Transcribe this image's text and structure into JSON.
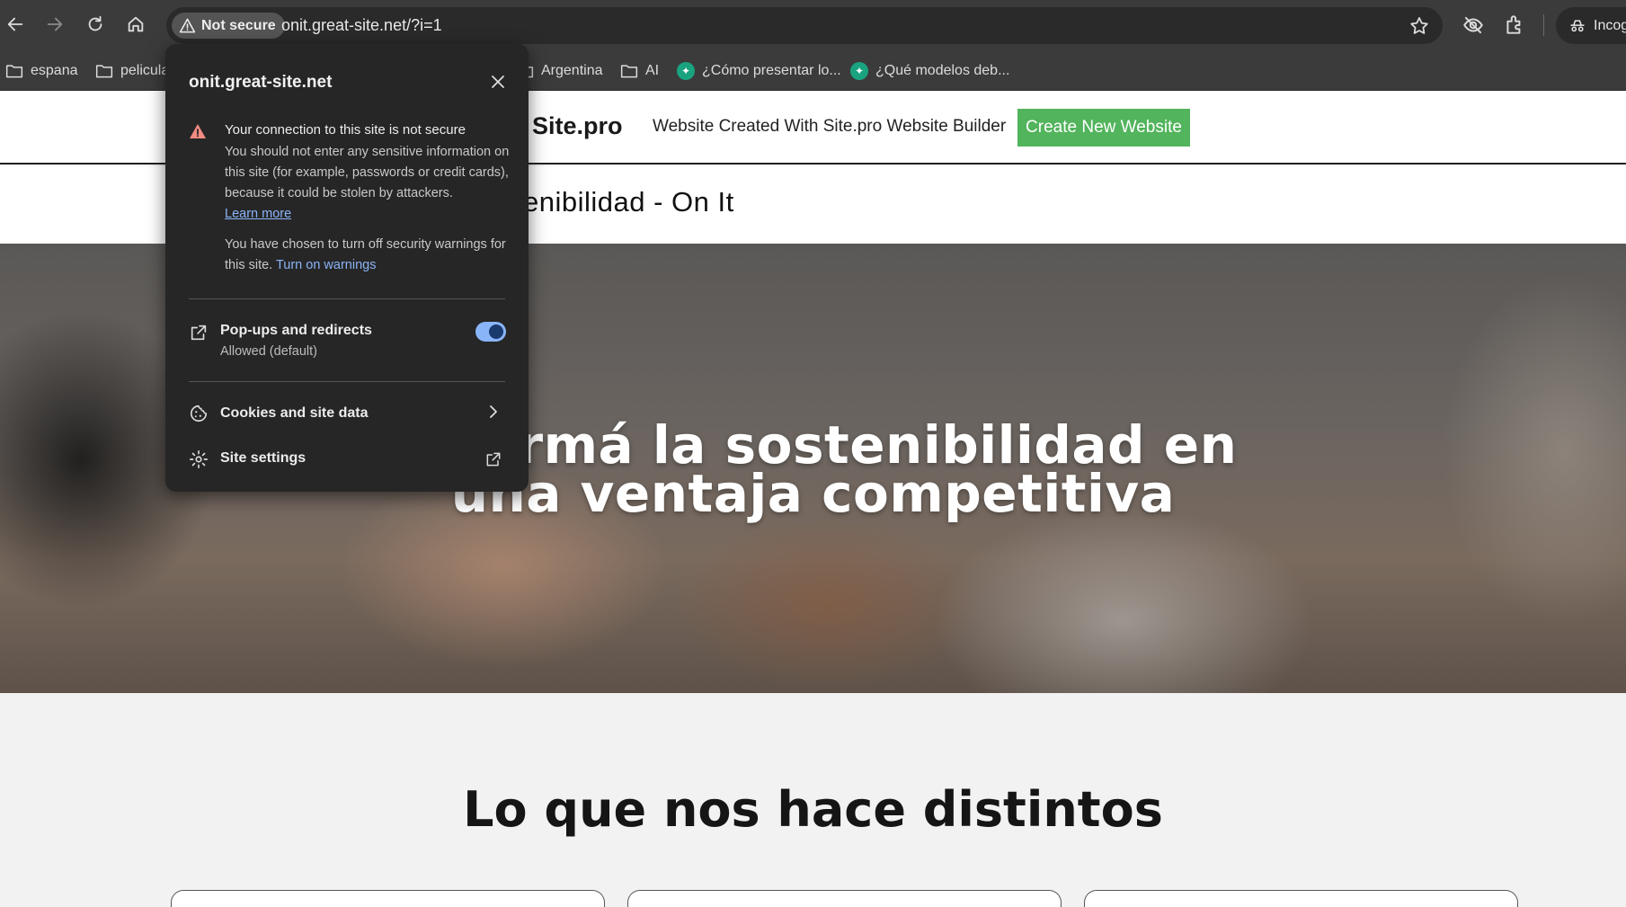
{
  "browser": {
    "security_chip": "Not secure",
    "url": "onit.great-site.net/?i=1",
    "incognito_label": "Incog"
  },
  "bookmarks": [
    {
      "label": "espana",
      "icon": "folder-icon"
    },
    {
      "label": "pelicula",
      "icon": "folder-icon"
    },
    {
      "label": "Argentina",
      "icon": "folder-icon"
    },
    {
      "label": "AI",
      "icon": "folder-icon"
    },
    {
      "label": "¿Cómo presentar lo...",
      "icon": "chatgpt-icon"
    },
    {
      "label": "¿Qué modelos deb...",
      "icon": "chatgpt-icon"
    }
  ],
  "builder_bar": {
    "brand": "Site.pro",
    "text": "Website Created With Site.pro Website Builder",
    "button": "Create New Website",
    "button_color": "#52b45c"
  },
  "site": {
    "title": "enibilidad  - On It",
    "hero_line1": "nsformá la sostenibilidad en",
    "hero_line2": "una ventaja competitiva",
    "section_title": "Lo que nos hace distintos"
  },
  "popup": {
    "site": "onit.great-site.net",
    "warning_title": "Your connection to this site is not secure",
    "warning_body": "You should not enter any sensitive information on this site (for example, passwords or credit cards), because it could be stolen by attackers.",
    "learn_more": "Learn more",
    "warnings_off": "You have chosen to turn off security warnings for this site.",
    "turn_on": "Turn on warnings",
    "popups_label": "Pop-ups and redirects",
    "popups_status": "Allowed (default)",
    "popups_enabled": true,
    "cookies_label": "Cookies and site data",
    "settings_label": "Site settings",
    "accent_color": "#8ab4f8"
  }
}
